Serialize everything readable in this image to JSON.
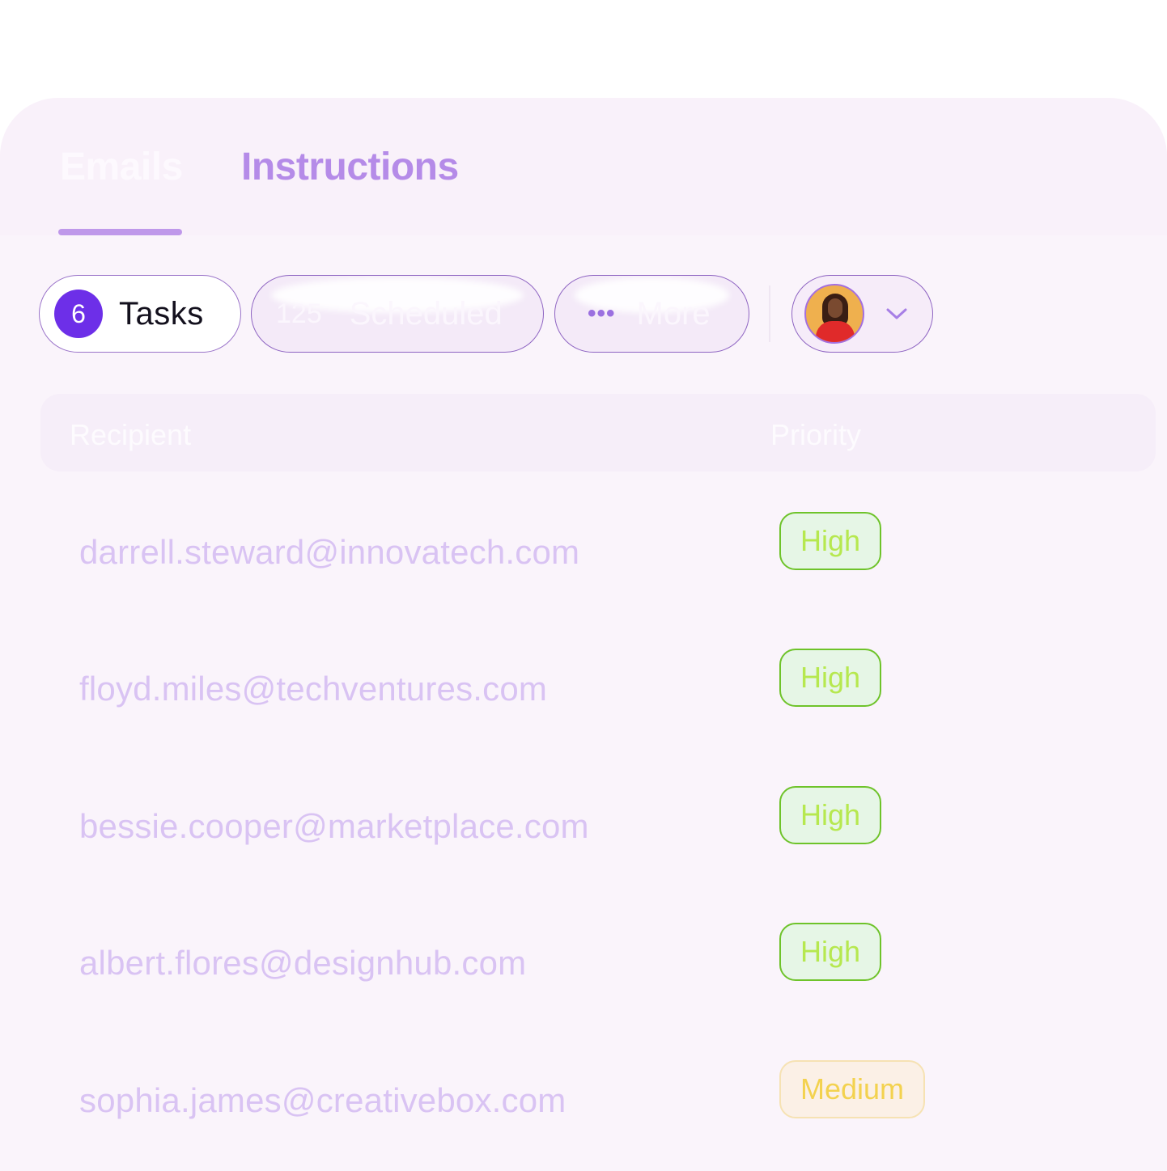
{
  "tabs": [
    {
      "label": "Emails",
      "active": true
    },
    {
      "label": "Instructions",
      "active": false
    }
  ],
  "filters": {
    "tasks": {
      "count": "6",
      "label": "Tasks"
    },
    "scheduled": {
      "count": "125",
      "label": "Scheduled"
    },
    "more": {
      "icon": "ellipsis-icon",
      "label": "More"
    },
    "user": {
      "avatar": "user-avatar",
      "icon": "chevron-down-icon"
    }
  },
  "table": {
    "columns": [
      "Recipient",
      "Priority"
    ],
    "rows": [
      {
        "recipient": "darrell.steward@innovatech.com",
        "priority": "High"
      },
      {
        "recipient": "floyd.miles@techventures.com",
        "priority": "High"
      },
      {
        "recipient": "bessie.cooper@marketplace.com",
        "priority": "High"
      },
      {
        "recipient": "albert.flores@designhub.com",
        "priority": "High"
      },
      {
        "recipient": "sophia.james@creativebox.com",
        "priority": "Medium"
      }
    ]
  },
  "colors": {
    "accent": "#6d2fe8",
    "tab_active_underline": "#bf98ea",
    "high_border": "#6ec32a",
    "medium_border": "#f6e2b3"
  }
}
